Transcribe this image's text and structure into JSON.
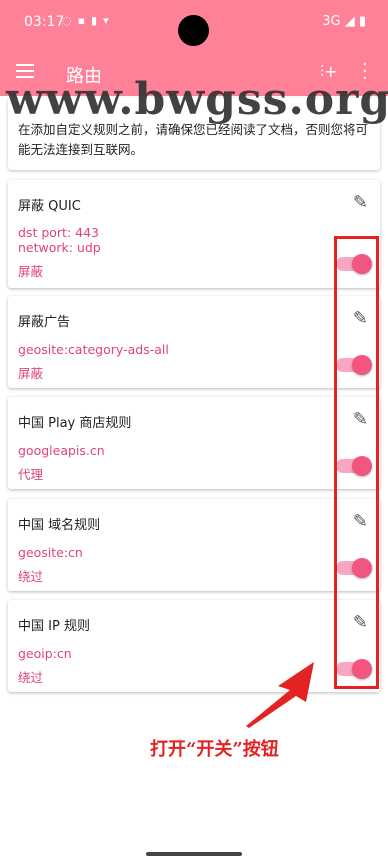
{
  "status_bar": {
    "time": "03:17",
    "network": "3G"
  },
  "app_bar": {
    "title": "路由",
    "menu_icon": "hamburger-icon",
    "add_icon": "add-rule-icon",
    "more_icon": "more-vert-icon"
  },
  "watermark": "www.bwgss.org",
  "notice": "在添加自定义规则之前，请确保您已经阅读了文档，否则您将可能无法连接到互联网。",
  "rules": [
    {
      "name": "屏蔽 QUIC",
      "rules": [
        "dst port: 443",
        "network: udp"
      ],
      "action": "屏蔽",
      "enabled": true
    },
    {
      "name": "屏蔽广告",
      "rules": [
        "geosite:category-ads-all"
      ],
      "action": "屏蔽",
      "enabled": true
    },
    {
      "name": "中国 Play 商店规则",
      "rules": [
        "googleapis.cn"
      ],
      "action": "代理",
      "enabled": true
    },
    {
      "name": "中国 域名规则",
      "rules": [
        "geosite:cn"
      ],
      "action": "绕过",
      "enabled": true
    },
    {
      "name": "中国 IP 规则",
      "rules": [
        "geoip:cn"
      ],
      "action": "绕过",
      "enabled": true
    }
  ],
  "annotation": "打开“开关”按钮",
  "colors": {
    "appbar": "#ff8198",
    "accent": "#e0447a",
    "highlight": "#e52222"
  }
}
